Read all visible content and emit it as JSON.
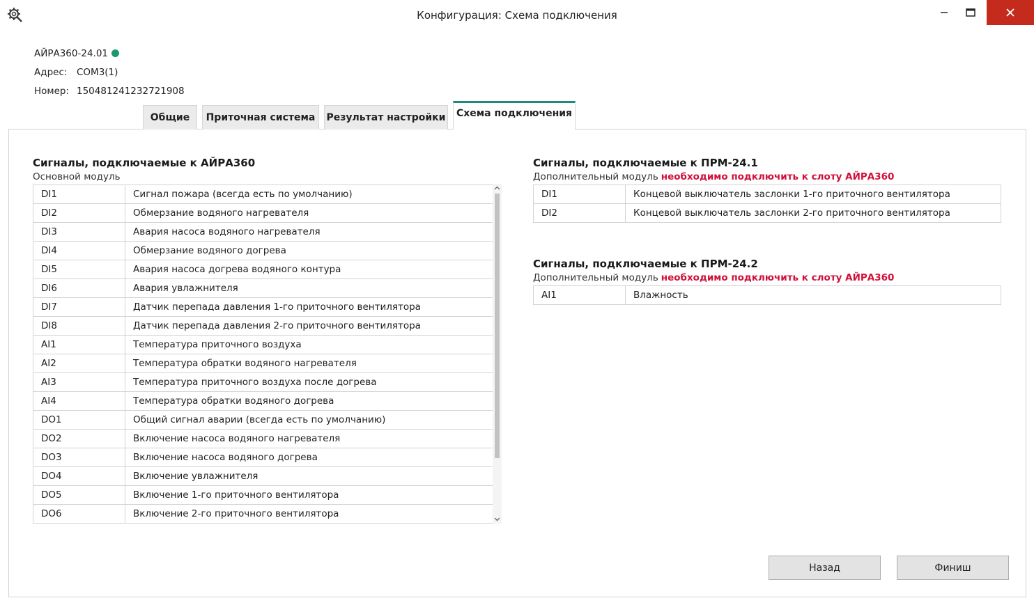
{
  "window": {
    "title": "Конфигурация: Схема подключения"
  },
  "device": {
    "name": "АЙРА360-24.01",
    "status_color": "#1d9a6c",
    "address_label": "Адрес:",
    "address": "COM3(1)",
    "number_label": "Номер:",
    "number": "150481241232721908"
  },
  "tabs": [
    {
      "label": "Общие",
      "active": false
    },
    {
      "label": "Приточная система",
      "active": false
    },
    {
      "label": "Результат настройки",
      "active": false
    },
    {
      "label": "Схема подключения",
      "active": true
    }
  ],
  "main_module": {
    "title": "Сигналы, подключаемые к АЙРА360",
    "subtitle": "Основной модуль",
    "rows": [
      {
        "code": "DI1",
        "desc": "Сигнал пожара (всегда есть по умолчанию)"
      },
      {
        "code": "DI2",
        "desc": "Обмерзание водяного нагревателя"
      },
      {
        "code": "DI3",
        "desc": "Авария насоса водяного нагревателя"
      },
      {
        "code": "DI4",
        "desc": "Обмерзание водяного догрева"
      },
      {
        "code": "DI5",
        "desc": "Авария насоса догрева водяного контура"
      },
      {
        "code": "DI6",
        "desc": "Авария увлажнителя"
      },
      {
        "code": "DI7",
        "desc": "Датчик перепада давления 1-го приточного вентилятора"
      },
      {
        "code": "DI8",
        "desc": "Датчик перепада давления 2-го приточного вентилятора"
      },
      {
        "code": "AI1",
        "desc": "Температура приточного воздуха"
      },
      {
        "code": "AI2",
        "desc": "Температура обратки водяного нагревателя"
      },
      {
        "code": "AI3",
        "desc": "Температура приточного воздуха после догрева"
      },
      {
        "code": "AI4",
        "desc": "Температура обратки водяного догрева"
      },
      {
        "code": "DO1",
        "desc": "Общий сигнал аварии (всегда есть по умолчанию)"
      },
      {
        "code": "DO2",
        "desc": "Включение насоса водяного нагревателя"
      },
      {
        "code": "DO3",
        "desc": "Включение насоса водяного догрева"
      },
      {
        "code": "DO4",
        "desc": "Включение увлажнителя"
      },
      {
        "code": "DO5",
        "desc": "Включение 1-го приточного вентилятора"
      },
      {
        "code": "DO6",
        "desc": "Включение 2-го приточного вентилятора"
      }
    ]
  },
  "prm1": {
    "title": "Сигналы, подключаемые к ПРМ-24.1",
    "subtitle": "Дополнительный модуль",
    "warning": "необходимо подключить к слоту АЙРА360",
    "rows": [
      {
        "code": "DI1",
        "desc": "Концевой выключатель заслонки 1-го приточного вентилятора"
      },
      {
        "code": "DI2",
        "desc": "Концевой выключатель заслонки 2-го приточного вентилятора"
      }
    ]
  },
  "prm2": {
    "title": "Сигналы, подключаемые к ПРМ-24.2",
    "subtitle": "Дополнительный модуль",
    "warning": "необходимо подключить к слоту АЙРА360",
    "rows": [
      {
        "code": "AI1",
        "desc": "Влажность"
      }
    ]
  },
  "buttons": {
    "back": "Назад",
    "finish": "Финиш"
  },
  "colors": {
    "accent": "#1f8a7a",
    "warning": "#d0103a",
    "close_button": "#c42b1c"
  }
}
